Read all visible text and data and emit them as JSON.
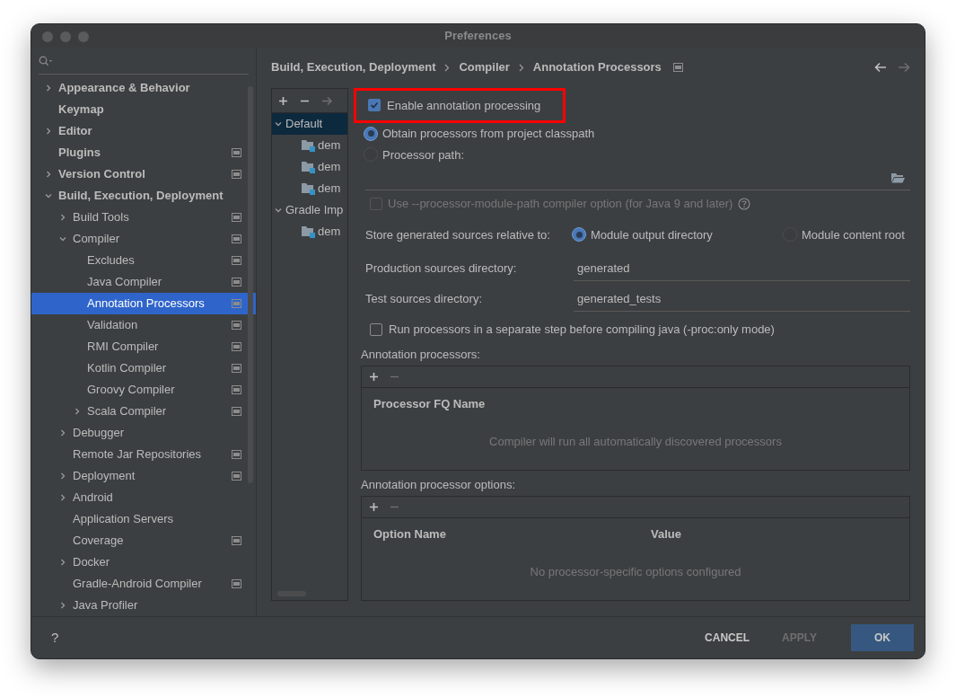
{
  "window": {
    "title": "Preferences"
  },
  "sidebar": {
    "items": [
      {
        "label": "Appearance & Behavior",
        "selected": false,
        "expanded": false,
        "has_children": true,
        "scope_icon": false
      },
      {
        "label": "Keymap",
        "selected": false,
        "has_children": false,
        "scope_icon": false
      },
      {
        "label": "Editor",
        "selected": false,
        "expanded": false,
        "has_children": true,
        "scope_icon": false
      },
      {
        "label": "Plugins",
        "selected": false,
        "has_children": false,
        "scope_icon": true
      },
      {
        "label": "Version Control",
        "selected": false,
        "expanded": false,
        "has_children": true,
        "scope_icon": true
      },
      {
        "label": "Build, Execution, Deployment",
        "selected": false,
        "expanded": true,
        "has_children": true,
        "scope_icon": false,
        "children": [
          {
            "label": "Build Tools",
            "selected": false,
            "expanded": false,
            "has_children": true,
            "scope_icon": true
          },
          {
            "label": "Compiler",
            "selected": false,
            "expanded": true,
            "has_children": true,
            "scope_icon": true,
            "children": [
              {
                "label": "Excludes",
                "selected": false,
                "has_children": false,
                "scope_icon": true
              },
              {
                "label": "Java Compiler",
                "selected": false,
                "has_children": false,
                "scope_icon": true
              },
              {
                "label": "Annotation Processors",
                "selected": true,
                "has_children": false,
                "scope_icon": true
              },
              {
                "label": "Validation",
                "selected": false,
                "has_children": false,
                "scope_icon": true
              },
              {
                "label": "RMI Compiler",
                "selected": false,
                "has_children": false,
                "scope_icon": true
              },
              {
                "label": "Kotlin Compiler",
                "selected": false,
                "has_children": false,
                "scope_icon": true
              },
              {
                "label": "Groovy Compiler",
                "selected": false,
                "has_children": false,
                "scope_icon": true
              },
              {
                "label": "Scala Compiler",
                "selected": false,
                "expanded": false,
                "has_children": true,
                "scope_icon": true
              }
            ]
          },
          {
            "label": "Debugger",
            "selected": false,
            "expanded": false,
            "has_children": true,
            "scope_icon": false
          },
          {
            "label": "Remote Jar Repositories",
            "selected": false,
            "has_children": false,
            "scope_icon": true
          },
          {
            "label": "Deployment",
            "selected": false,
            "expanded": false,
            "has_children": true,
            "scope_icon": true
          },
          {
            "label": "Android",
            "selected": false,
            "expanded": false,
            "has_children": true,
            "scope_icon": false
          },
          {
            "label": "Application Servers",
            "selected": false,
            "has_children": false,
            "scope_icon": false
          },
          {
            "label": "Coverage",
            "selected": false,
            "has_children": false,
            "scope_icon": true
          },
          {
            "label": "Docker",
            "selected": false,
            "expanded": false,
            "has_children": true,
            "scope_icon": false
          },
          {
            "label": "Gradle-Android Compiler",
            "selected": false,
            "has_children": false,
            "scope_icon": true
          },
          {
            "label": "Java Profiler",
            "selected": false,
            "expanded": false,
            "has_children": true,
            "scope_icon": false
          }
        ]
      }
    ]
  },
  "breadcrumb": [
    "Build, Execution, Deployment",
    "Compiler",
    "Annotation Processors"
  ],
  "nav": {
    "back_disabled": false,
    "forward_disabled": true
  },
  "profiles": {
    "items": [
      {
        "label": "Default",
        "selected": true,
        "expanded": true,
        "children": [
          {
            "label": "dem",
            "selected": false
          },
          {
            "label": "dem",
            "selected": false
          },
          {
            "label": "dem",
            "selected": false
          }
        ]
      },
      {
        "label": "Gradle Imp",
        "selected": false,
        "expanded": true,
        "children": [
          {
            "label": "dem",
            "selected": false
          }
        ]
      }
    ]
  },
  "enable_processing": {
    "label": "Enable annotation processing",
    "checked": true,
    "highlighted": true
  },
  "source": [
    {
      "label": "Obtain processors from project classpath",
      "selected": true
    },
    {
      "label": "Processor path:",
      "selected": false
    }
  ],
  "module_path_option": {
    "label": "Use --processor-module-path compiler option (for Java 9 and later)",
    "checked": false,
    "disabled": true
  },
  "store_relative": {
    "label": "Store generated sources relative to:",
    "options": [
      {
        "label": "Module output directory",
        "selected": true
      },
      {
        "label": "Module content root",
        "selected": false
      }
    ]
  },
  "directories": [
    {
      "label": "Production sources directory:",
      "value": "generated"
    },
    {
      "label": "Test sources directory:",
      "value": "generated_tests"
    }
  ],
  "separate_step": {
    "label": "Run processors in a separate step before compiling java (-proc:only mode)",
    "checked": false
  },
  "processors": {
    "label": "Annotation processors:",
    "columns": [
      "Processor FQ Name"
    ],
    "empty_text": "Compiler will run all automatically discovered processors"
  },
  "options": {
    "label": "Annotation processor options:",
    "columns": [
      "Option Name",
      "Value"
    ],
    "empty_text": "No processor-specific options configured"
  },
  "footer": {
    "help": "?",
    "buttons": [
      {
        "label": "CANCEL",
        "disabled": false,
        "primary": false
      },
      {
        "label": "APPLY",
        "disabled": true,
        "primary": false
      },
      {
        "label": "OK",
        "disabled": false,
        "primary": true
      }
    ]
  }
}
